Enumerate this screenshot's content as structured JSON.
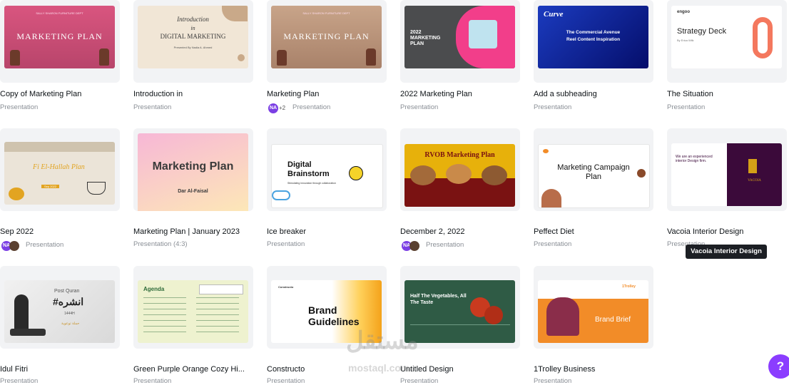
{
  "cards": [
    {
      "title": "Copy of Marketing Plan",
      "subtitle": "Presentation",
      "thumb": {
        "heading": "MARKETING PLAN",
        "small": "SALLY SHARON FURNITURE DEPT"
      }
    },
    {
      "title": "Introduction in",
      "subtitle": "Presentation",
      "thumb": {
        "line1": "Introduction",
        "line2": "in",
        "line3": "DIGITAL MARKETING",
        "small": "Presented By Nadia A. Ahmed"
      }
    },
    {
      "title": "Marketing Plan",
      "subtitle": "Presentation",
      "avatar": "NA",
      "extra": "+2",
      "thumb": {
        "heading": "MARKETING PLAN",
        "small": "SALLY SHARON FURNITURE DEPT"
      }
    },
    {
      "title": "2022 Marketing Plan",
      "subtitle": "Presentation",
      "thumb": {
        "heading": "2022 MARKETING PLAN"
      }
    },
    {
      "title": "Add a subheading",
      "subtitle": "Presentation",
      "thumb": {
        "logo": "Curve",
        "line1": "The Commercial Avenue",
        "line2": "Reel Content Inspiration"
      }
    },
    {
      "title": "The Situation",
      "subtitle": "Presentation",
      "thumb": {
        "logo": "engoo",
        "heading": "Strategy Deck",
        "small": "By Erica Wilk"
      }
    },
    {
      "title": "Sep 2022",
      "subtitle": "Presentation",
      "avatar": "NA",
      "thumb": {
        "heading": "Fi El-Hallah Plan",
        "small": "Sep 2022"
      }
    },
    {
      "title": "Marketing Plan | January 2023",
      "subtitle": "Presentation (4:3)",
      "thumb": {
        "heading": "Marketing Plan",
        "small": "Dar Al-Faisal"
      }
    },
    {
      "title": "Ice breaker",
      "subtitle": "Presentation",
      "thumb": {
        "heading": "Digital Brainstorm",
        "small": "Stimulating innovation through collaboration"
      }
    },
    {
      "title": "December 2, 2022",
      "subtitle": "Presentation",
      "avatar": "NA",
      "thumb": {
        "heading": "RVOB Marketing Plan"
      }
    },
    {
      "title": "Peffect Diet",
      "subtitle": "Presentation",
      "thumb": {
        "heading": "Marketing Campaign Plan"
      }
    },
    {
      "title": "Vacoia Interior Design",
      "subtitle": "Presentation",
      "thumb": {
        "heading": "We are an experienced interior Design firm.",
        "logo": "VACOIA"
      }
    },
    {
      "title": "Idul Fitri",
      "subtitle": "Presentation",
      "thumb": {
        "small": "Post Quran",
        "heading": "#انشره",
        "line1": "1444H",
        "line2": "حملة توعوية"
      }
    },
    {
      "title": "Green Purple Orange Cozy Hi...",
      "subtitle": "Presentation",
      "thumb": {
        "heading": "Agenda"
      }
    },
    {
      "title": "Constructo",
      "subtitle": "Presentation",
      "thumb": {
        "logo": "Constructo",
        "heading": "Brand Guidelines"
      }
    },
    {
      "title": "Untitled Design",
      "subtitle": "Presentation",
      "thumb": {
        "heading": "Half The Vegetables, All The Taste"
      }
    },
    {
      "title": "1Trolley Business",
      "subtitle": "Presentation",
      "thumb": {
        "logo": "1Trolley",
        "heading": "Brand Brief"
      }
    }
  ],
  "tooltip": "Vacoia Interior Design",
  "help_label": "?",
  "watermark": {
    "arabic": "مستقل",
    "latin": "mostaql.com"
  },
  "colors": {
    "accent": "#8b3dff",
    "card_bg": "#f2f3f5",
    "muted": "#8a8f96"
  }
}
